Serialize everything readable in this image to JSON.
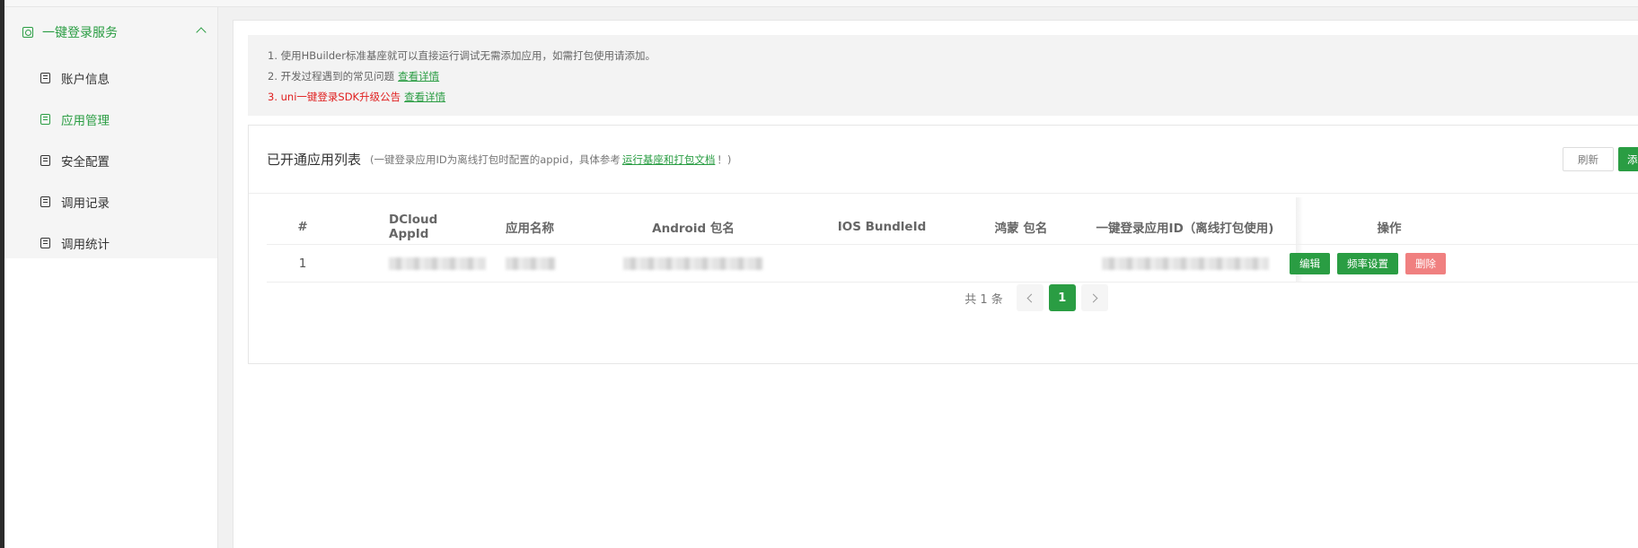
{
  "sidebar": {
    "group_label": "一键登录服务",
    "items": [
      {
        "label": "账户信息",
        "active": false
      },
      {
        "label": "应用管理",
        "active": true
      },
      {
        "label": "安全配置",
        "active": false
      },
      {
        "label": "调用记录",
        "active": false
      },
      {
        "label": "调用统计",
        "active": false
      }
    ]
  },
  "notice": {
    "line1": "1. 使用HBuilder标准基座就可以直接运行调试无需添加应用，如需打包使用请添加。",
    "line2_text": "2. 开发过程遇到的常见问题",
    "line2_link": "查看详情",
    "line3_text": "3. uni一键登录SDK升级公告",
    "line3_link": "查看详情"
  },
  "card": {
    "title": "已开通应用列表",
    "sub_prefix": "(一键登录应用ID为离线打包时配置的appid，具体参考",
    "sub_link": "运行基座和打包文档",
    "sub_suffix": "！)",
    "refresh_label": "刷新",
    "add_label": "添"
  },
  "table": {
    "columns": [
      "#",
      "DCloud AppId",
      "应用名称",
      "Android 包名",
      "IOS BundleId",
      "鸿蒙 包名",
      "一键登录应用ID（离线打包使用)",
      "操作"
    ],
    "rows": [
      {
        "index": "1"
      }
    ],
    "ops": {
      "edit": "编辑",
      "rate": "频率设置",
      "delete": "删除"
    }
  },
  "pager": {
    "total": "共 1 条",
    "current": "1"
  },
  "colors": {
    "accent": "#2a9d43",
    "danger": "#e02020"
  }
}
